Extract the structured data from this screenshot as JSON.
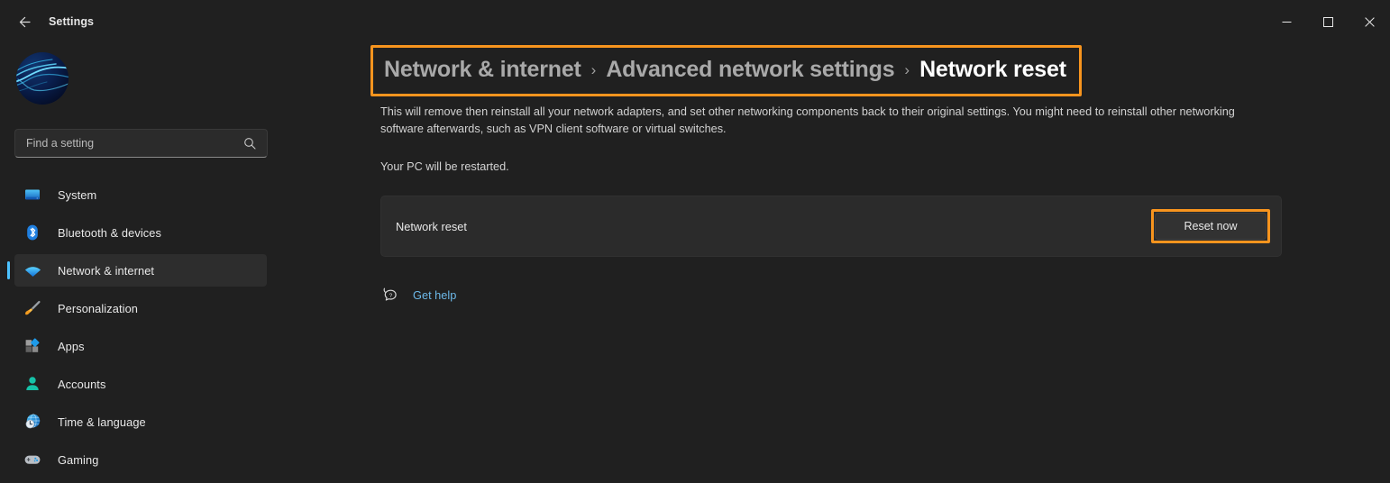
{
  "titlebar": {
    "back_label": "back-arrow",
    "title": "Settings",
    "minimize_label": "Minimize",
    "maximize_label": "Maximize",
    "close_label": "Close"
  },
  "sidebar": {
    "avatar_label": "user-avatar",
    "search": {
      "placeholder": "Find a setting",
      "value": ""
    },
    "items": [
      {
        "label": "System",
        "icon": "monitor-icon",
        "active": false
      },
      {
        "label": "Bluetooth & devices",
        "icon": "bluetooth-icon",
        "active": false
      },
      {
        "label": "Network & internet",
        "icon": "wifi-icon",
        "active": true
      },
      {
        "label": "Personalization",
        "icon": "paintbrush-icon",
        "active": false
      },
      {
        "label": "Apps",
        "icon": "apps-icon",
        "active": false
      },
      {
        "label": "Accounts",
        "icon": "person-icon",
        "active": false
      },
      {
        "label": "Time & language",
        "icon": "clock-globe-icon",
        "active": false
      },
      {
        "label": "Gaming",
        "icon": "gamepad-icon",
        "active": false
      }
    ]
  },
  "main": {
    "breadcrumb": {
      "crumb1": "Network & internet",
      "sep1": "›",
      "crumb2": "Advanced network settings",
      "sep2": "›",
      "current": "Network reset"
    },
    "description": "This will remove then reinstall all your network adapters, and set other networking components back to their original settings. You might need to reinstall other networking software afterwards, such as VPN client software or virtual switches.",
    "description2": "Your PC will be restarted.",
    "card": {
      "label": "Network reset",
      "button_label": "Reset now"
    },
    "help": {
      "icon": "help-bubble-icon",
      "label": "Get help"
    }
  },
  "colors": {
    "highlight": "#f7941e",
    "accent": "#4cc2ff",
    "link": "#6cb8e8",
    "window_bg": "#202020",
    "card_bg": "#2b2b2b"
  }
}
